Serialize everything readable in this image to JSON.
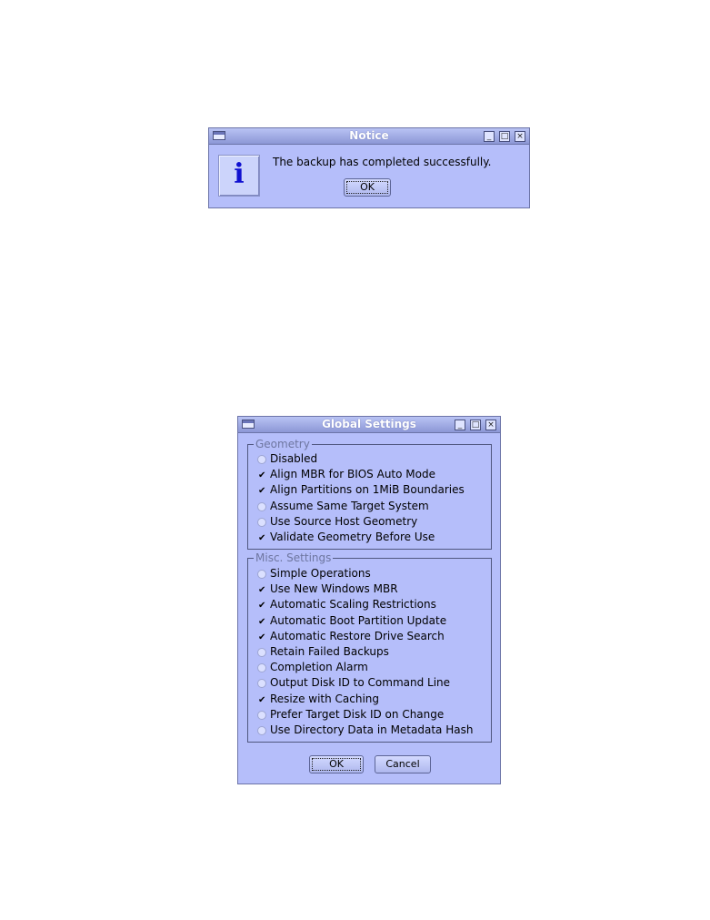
{
  "notice": {
    "title": "Notice",
    "icon": "info-icon",
    "icon_glyph": "i",
    "message": "The backup has completed successfully.",
    "ok_label": "OK"
  },
  "settings": {
    "title": "Global Settings",
    "geometry": {
      "legend": "Geometry",
      "options": [
        {
          "label": "Disabled",
          "checked": false
        },
        {
          "label": "Align MBR for BIOS Auto Mode",
          "checked": true
        },
        {
          "label": "Align Partitions on 1MiB Boundaries",
          "checked": true
        },
        {
          "label": "Assume Same Target System",
          "checked": false
        },
        {
          "label": "Use Source Host Geometry",
          "checked": false
        },
        {
          "label": "Validate Geometry Before Use",
          "checked": true
        }
      ]
    },
    "misc": {
      "legend": "Misc. Settings",
      "options": [
        {
          "label": "Simple Operations",
          "checked": false
        },
        {
          "label": "Use New Windows MBR",
          "checked": true
        },
        {
          "label": "Automatic Scaling Restrictions",
          "checked": true
        },
        {
          "label": "Automatic Boot Partition Update",
          "checked": true
        },
        {
          "label": "Automatic Restore Drive Search",
          "checked": true
        },
        {
          "label": "Retain Failed Backups",
          "checked": false
        },
        {
          "label": "Completion Alarm",
          "checked": false
        },
        {
          "label": "Output Disk ID to Command Line",
          "checked": false
        },
        {
          "label": "Resize with Caching",
          "checked": true
        },
        {
          "label": "Prefer Target Disk ID on Change",
          "checked": false
        },
        {
          "label": "Use Directory Data in Metadata Hash",
          "checked": false
        }
      ]
    },
    "ok_label": "OK",
    "cancel_label": "Cancel"
  },
  "window_buttons": {
    "minimize": "_",
    "maximize": "□",
    "close": "×"
  },
  "check_glyph": "✔",
  "colors": {
    "dialog_bg": "#b5befa",
    "titlebar": "#8c97d6",
    "info_icon": "#1010d0"
  }
}
